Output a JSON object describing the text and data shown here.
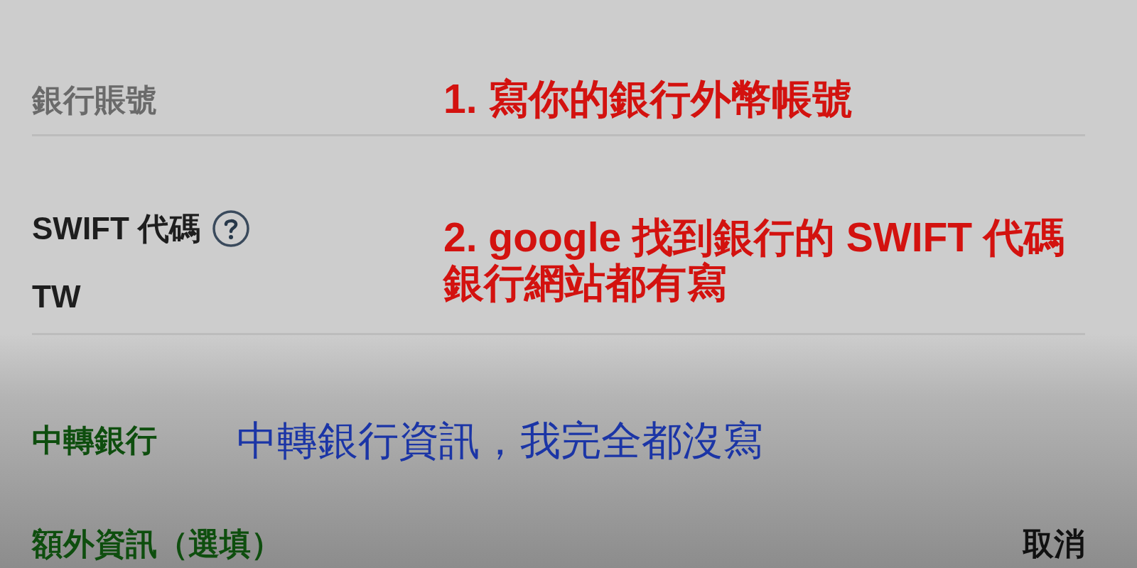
{
  "fields": [
    {
      "kind": "placeholder_input",
      "placeholder": "銀行賬號",
      "annotation": [
        "1. 寫你的銀行外幣帳號"
      ]
    },
    {
      "kind": "labeled_input",
      "label": "SWIFT 代碼",
      "help": true,
      "value": "TW",
      "annotation": [
        "2. google 找到銀行的 SWIFT 代碼",
        "銀行網站都有寫"
      ]
    }
  ],
  "sections": [
    {
      "title": "中轉銀行",
      "annotation": "中轉銀行資訊，我完全都沒寫"
    },
    {
      "title": "額外資訊（選填）"
    }
  ],
  "cancel_button": {
    "label": "取消"
  }
}
